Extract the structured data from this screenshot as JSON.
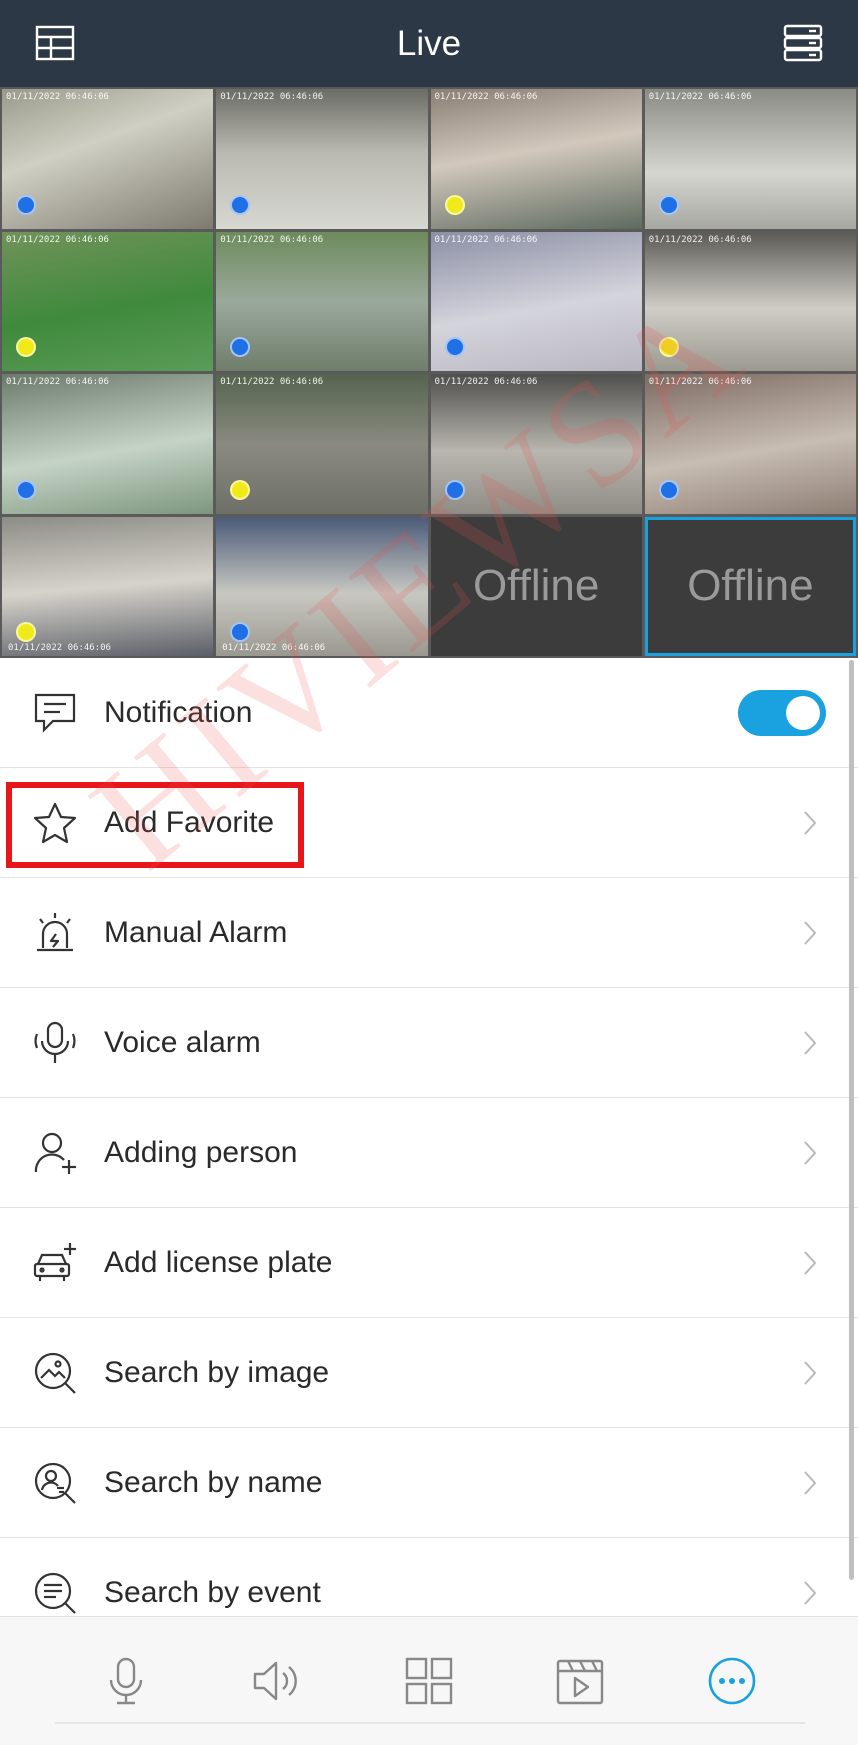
{
  "header": {
    "title": "Live",
    "left_icon": "layout-icon",
    "right_icon": "device-list-icon",
    "background": "#2d3847"
  },
  "cameras": [
    {
      "status": "live",
      "dot": "blue",
      "timestamp": "01/11/2022 06:46:06"
    },
    {
      "status": "live",
      "dot": "blue",
      "timestamp": "01/11/2022 06:46:06"
    },
    {
      "status": "live",
      "dot": "yellow",
      "timestamp": "01/11/2022 06:46:06"
    },
    {
      "status": "live",
      "dot": "blue",
      "timestamp": "01/11/2022 06:46:06"
    },
    {
      "status": "live",
      "dot": "yellow",
      "timestamp": "01/11/2022 06:46:06"
    },
    {
      "status": "live",
      "dot": "blue",
      "timestamp": "01/11/2022 06:46:06"
    },
    {
      "status": "live",
      "dot": "blue",
      "timestamp": "01/11/2022 06:46:06"
    },
    {
      "status": "live",
      "dot": "yellow",
      "timestamp": "01/11/2022 06:46:06"
    },
    {
      "status": "live",
      "dot": "blue",
      "timestamp": "01/11/2022 06:46:06"
    },
    {
      "status": "live",
      "dot": "yellow",
      "timestamp": "01/11/2022 06:46:06"
    },
    {
      "status": "live",
      "dot": "blue",
      "timestamp": "01/11/2022 06:46:06"
    },
    {
      "status": "live",
      "dot": "blue",
      "timestamp": "01/11/2022 06:46:06"
    },
    {
      "status": "live",
      "dot": "yellow",
      "timestamp": "01/11/2022 06:46:06"
    },
    {
      "status": "live",
      "dot": "blue",
      "timestamp": "01/11/2022 06:46:06"
    },
    {
      "status": "offline",
      "label": "Offline"
    },
    {
      "status": "offline",
      "label": "Offline",
      "selected": true
    }
  ],
  "menu": {
    "items": [
      {
        "label": "Notification",
        "icon": "message-icon",
        "control": "toggle",
        "toggle_on": true
      },
      {
        "label": "Add Favorite",
        "icon": "star-icon",
        "control": "chevron",
        "highlighted": true
      },
      {
        "label": "Manual Alarm",
        "icon": "alarm-light-icon",
        "control": "chevron"
      },
      {
        "label": "Voice alarm",
        "icon": "mic-alarm-icon",
        "control": "chevron"
      },
      {
        "label": "Adding person",
        "icon": "person-add-icon",
        "control": "chevron"
      },
      {
        "label": "Add license plate",
        "icon": "car-add-icon",
        "control": "chevron"
      },
      {
        "label": "Search by image",
        "icon": "image-search-icon",
        "control": "chevron"
      },
      {
        "label": "Search by name",
        "icon": "name-search-icon",
        "control": "chevron"
      },
      {
        "label": "Search by event",
        "icon": "event-search-icon",
        "control": "chevron"
      }
    ]
  },
  "watermark": "HIVIEWSA",
  "bottombar": {
    "items": [
      "microphone-icon",
      "speaker-icon",
      "grid-icon",
      "playback-icon",
      "more-icon"
    ],
    "active": "more-icon"
  },
  "colors": {
    "accent": "#1aa1e0",
    "highlight_box": "#e8151b",
    "dot_blue": "#1f6fe5",
    "dot_yellow": "#f0ea1a"
  }
}
